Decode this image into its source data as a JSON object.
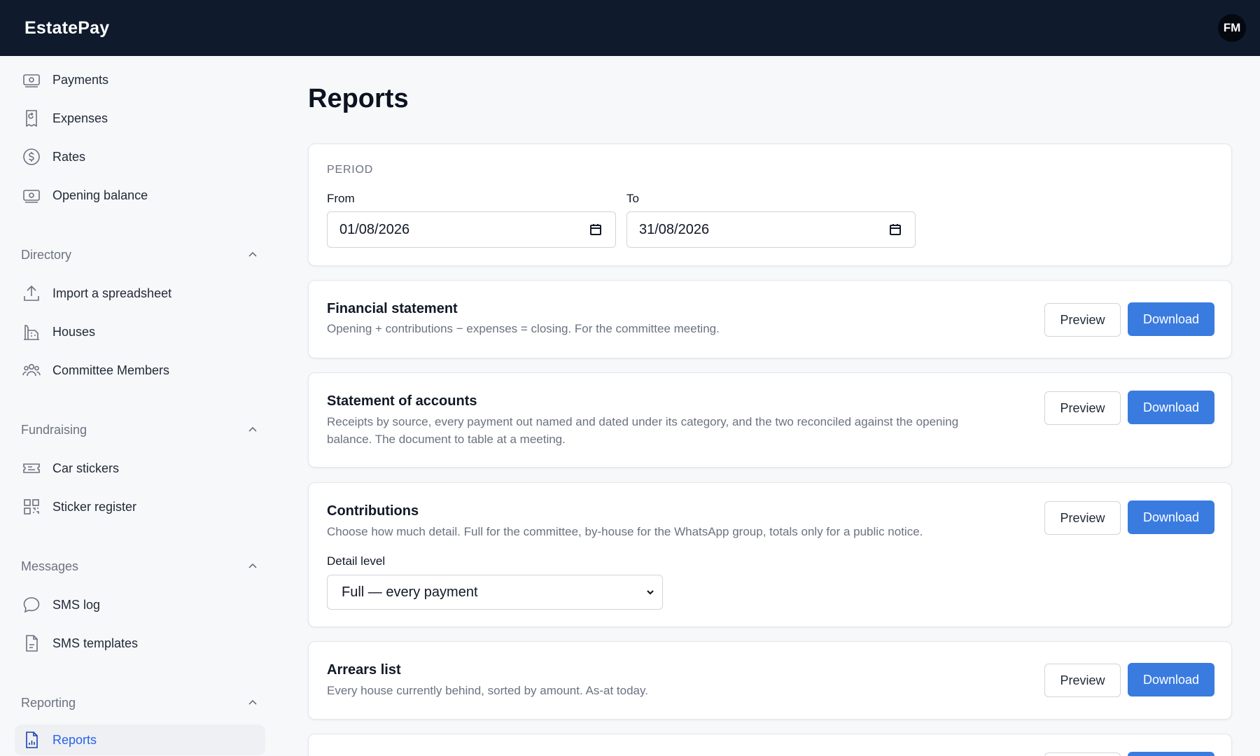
{
  "app": {
    "brand": "EstatePay",
    "user_initials": "FM"
  },
  "sidebar": {
    "items_top": [
      {
        "label": "Payments",
        "icon": "banknote-icon"
      },
      {
        "label": "Expenses",
        "icon": "receipt-icon"
      },
      {
        "label": "Rates",
        "icon": "dollar-circle-icon"
      },
      {
        "label": "Opening balance",
        "icon": "banknote-icon"
      }
    ],
    "sections": [
      {
        "label": "Directory",
        "items": [
          {
            "label": "Import a spreadsheet",
            "icon": "upload-icon"
          },
          {
            "label": "Houses",
            "icon": "building-icon"
          },
          {
            "label": "Committee Members",
            "icon": "users-icon"
          }
        ]
      },
      {
        "label": "Fundraising",
        "items": [
          {
            "label": "Car stickers",
            "icon": "ticket-icon"
          },
          {
            "label": "Sticker register",
            "icon": "qr-code-icon"
          }
        ]
      },
      {
        "label": "Messages",
        "items": [
          {
            "label": "SMS log",
            "icon": "chat-bubble-icon"
          },
          {
            "label": "SMS templates",
            "icon": "document-icon"
          }
        ]
      },
      {
        "label": "Reporting",
        "items": [
          {
            "label": "Reports",
            "icon": "report-icon",
            "active": true
          }
        ]
      }
    ]
  },
  "main": {
    "title": "Reports",
    "period": {
      "heading": "PERIOD",
      "from_label": "From",
      "from_value": "01/08/2026",
      "to_label": "To",
      "to_value": "31/08/2026"
    },
    "reports": [
      {
        "title": "Financial statement",
        "desc_lines": [
          "Opening + contributions − expenses = closing. For the committee meeting."
        ]
      },
      {
        "title": "Statement of accounts",
        "desc_lines": [
          "Receipts by source, every payment out named and dated under its category, and the two reconciled against the opening",
          "balance. The document to table at a meeting."
        ]
      },
      {
        "title": "Contributions",
        "desc_lines": [
          "Choose how much detail. Full for the committee, by-house for the WhatsApp group, totals only for a public notice."
        ],
        "detail_label": "Detail level",
        "detail_value": "Full — every payment"
      },
      {
        "title": "Arrears list",
        "desc_lines": [
          "Every house currently behind, sorted by amount. As-at today."
        ]
      }
    ],
    "preview_label": "Preview",
    "download_label": "Download"
  },
  "colors": {
    "topbar": "#0f1a2c",
    "accent": "#3a7be0",
    "active_nav_bg": "#eef0f4"
  }
}
